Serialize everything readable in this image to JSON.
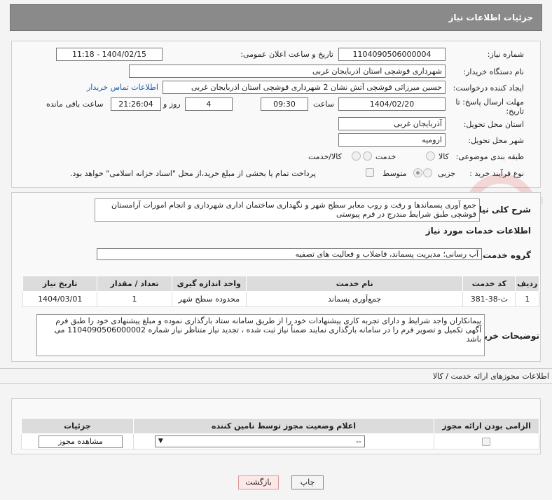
{
  "header": {
    "title": "جزئیات اطلاعات نیاز"
  },
  "fields": {
    "need_number_label": "شماره نیاز:",
    "need_number": "1104090506000004",
    "announce_label": "تاریخ و ساعت اعلان عمومی:",
    "announce_value": "1404/02/15 - 11:18",
    "buyer_org_label": "نام دستگاه خریدار:",
    "buyer_org": "شهرداری قوشچی استان اذربایجان غربی",
    "creator_label": "ایجاد کننده درخواست:",
    "creator": "حسین میرزائی قوشچی آتش نشان 2 شهرداری قوشچی استان اذربایجان غربی",
    "contact_link": "اطلاعات تماس خریدار",
    "deadline_label_1": "مهلت ارسال پاسخ: تا",
    "deadline_label_2": "تاریخ:",
    "deadline_date": "1404/02/20",
    "time_label": "ساعت",
    "deadline_time": "09:30",
    "days": "4",
    "days_label": "روز و",
    "remaining": "21:26:04",
    "remaining_label": "ساعت باقی مانده",
    "province_label": "استان محل تحویل:",
    "province": "آذربایجان غربی",
    "city_label": "شهر محل تحویل:",
    "city": "ارومیه",
    "category_label": "طبقه بندی موضوعی:",
    "category_options": [
      "کالا",
      "خدمت",
      "کالا/خدمت"
    ],
    "purchase_label": "نوع فرآیند خرید :",
    "purchase_options": [
      "جزیی",
      "متوسط"
    ],
    "payment_note": "پرداخت تمام یا بخشی از مبلغ خرید،از محل \"اسناد خزانه اسلامی\" خواهد بود."
  },
  "summary": {
    "label": "شرح کلی نیاز:",
    "text": "جمع آوری پسماندها و رفت و روب معابر سطح شهر و نگهداری ساختمان اداری شهرداری و انجام امورات آرامستان قوشچی طبق شرایط مندرج در فرم پیوستی"
  },
  "services": {
    "title": "اطلاعات خدمات مورد نیاز",
    "group_label": "گروه خدمت:",
    "group_value": "آب رسانی؛ مدیریت پسماند، فاضلاب و فعالیت های تصفیه",
    "columns": [
      "ردیف",
      "کد خدمت",
      "نام خدمت",
      "واحد اندازه گیری",
      "تعداد / مقدار",
      "تاریخ نیاز"
    ],
    "rows": [
      [
        "1",
        "ث-38-381",
        "جمع‌آوری پسماند",
        "محدوده سطح شهر",
        "1",
        "1404/03/01"
      ]
    ]
  },
  "buyer_notes": {
    "label": "توضیحات خریدار:",
    "text": "پیمانکاران واجد شرایط و دارای تجربه کاری پیشنهادات خود را از طریق سامانه ستاد بارگذاری نموده و مبلغ پیشنهادی خود را طبق فرم آگهی تکمیل و تصویر فرم را در سامانه بارگذاری نمایند ضمناً نیاز ثبت شده ، تجدید نیاز متناظر نیاز شماره 1104090506000002 می باشد"
  },
  "permits": {
    "title": "اطلاعات مجوزهای ارائه خدمت / کالا",
    "columns": [
      "الزامی بودن ارائه مجوز",
      "اعلام وضعیت مجوز توسط نامین کننده",
      "جزئیات"
    ],
    "select_value": "--",
    "view_button": "مشاهده مجوز"
  },
  "actions": {
    "print": "چاپ",
    "back": "بازگشت"
  },
  "watermark_text": "AriaTender.neT"
}
